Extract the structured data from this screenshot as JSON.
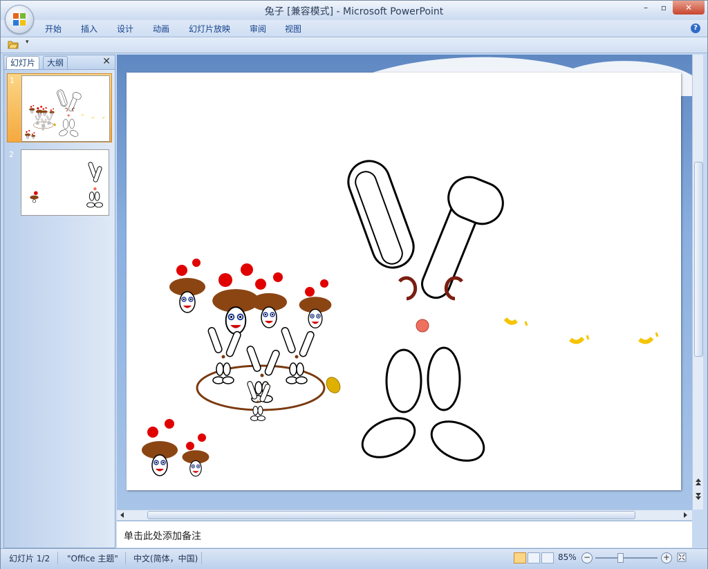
{
  "window": {
    "title": "兔子 [兼容模式] - Microsoft PowerPoint",
    "minimize": "–",
    "restore": "▫",
    "close": "✕"
  },
  "ribbon": {
    "tabs": [
      "开始",
      "插入",
      "设计",
      "动画",
      "幻灯片放映",
      "审阅",
      "视图"
    ],
    "help": "?"
  },
  "quick_access": {
    "more": "▾"
  },
  "left_pane": {
    "tabs": [
      "幻灯片",
      "大纲"
    ],
    "close": "✕",
    "slides": [
      {
        "number": "1",
        "selected": true
      },
      {
        "number": "2",
        "selected": false
      }
    ]
  },
  "notes": {
    "placeholder": "单击此处添加备注"
  },
  "status_bar": {
    "slide_info": "幻灯片 1/2",
    "theme": "\"Office 主题\"",
    "language": "中文(简体，中国)",
    "zoom": "85%",
    "zoom_out": "−",
    "zoom_in": "+"
  },
  "colors": {
    "accent_selected": "#f5a93f",
    "mushroom_cap": "#8b4513",
    "dot_red": "#e00000",
    "nose": "#f07060",
    "brown_ring": "#7a3a10",
    "yellow": "#f5c400"
  }
}
